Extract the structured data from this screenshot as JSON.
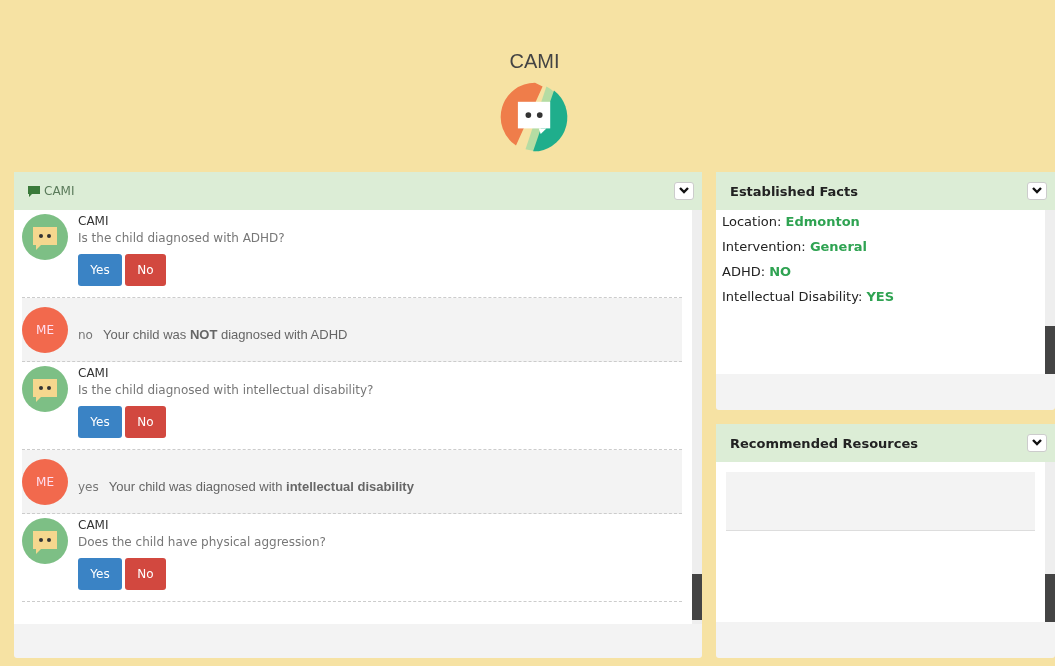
{
  "header": {
    "title": "CAMI"
  },
  "chat": {
    "title": "CAMI",
    "messages": [
      {
        "kind": "bot",
        "sender": "CAMI",
        "text": "Is the child diagnosed with ADHD?",
        "buttons": [
          "Yes",
          "No"
        ]
      },
      {
        "kind": "user",
        "avatar": "ME",
        "answer": "no",
        "text": "Your child was **NOT** diagnosed with ADHD"
      },
      {
        "kind": "bot",
        "sender": "CAMI",
        "text": "Is the child diagnosed with intellectual disability?",
        "buttons": [
          "Yes",
          "No"
        ]
      },
      {
        "kind": "user",
        "avatar": "ME",
        "answer": "yes",
        "text": "Your child was diagnosed with **intellectual disability**"
      },
      {
        "kind": "bot",
        "sender": "CAMI",
        "text": "Does the child have physical aggression?",
        "buttons": [
          "Yes",
          "No"
        ]
      }
    ]
  },
  "facts": {
    "title": "Established Facts",
    "items": [
      {
        "label": "Location:",
        "value": "Edmonton"
      },
      {
        "label": "Intervention:",
        "value": "General"
      },
      {
        "label": "ADHD:",
        "value": "NO"
      },
      {
        "label": "Intellectual Disability:",
        "value": "YES"
      }
    ]
  },
  "resources": {
    "title": "Recommended Resources"
  }
}
